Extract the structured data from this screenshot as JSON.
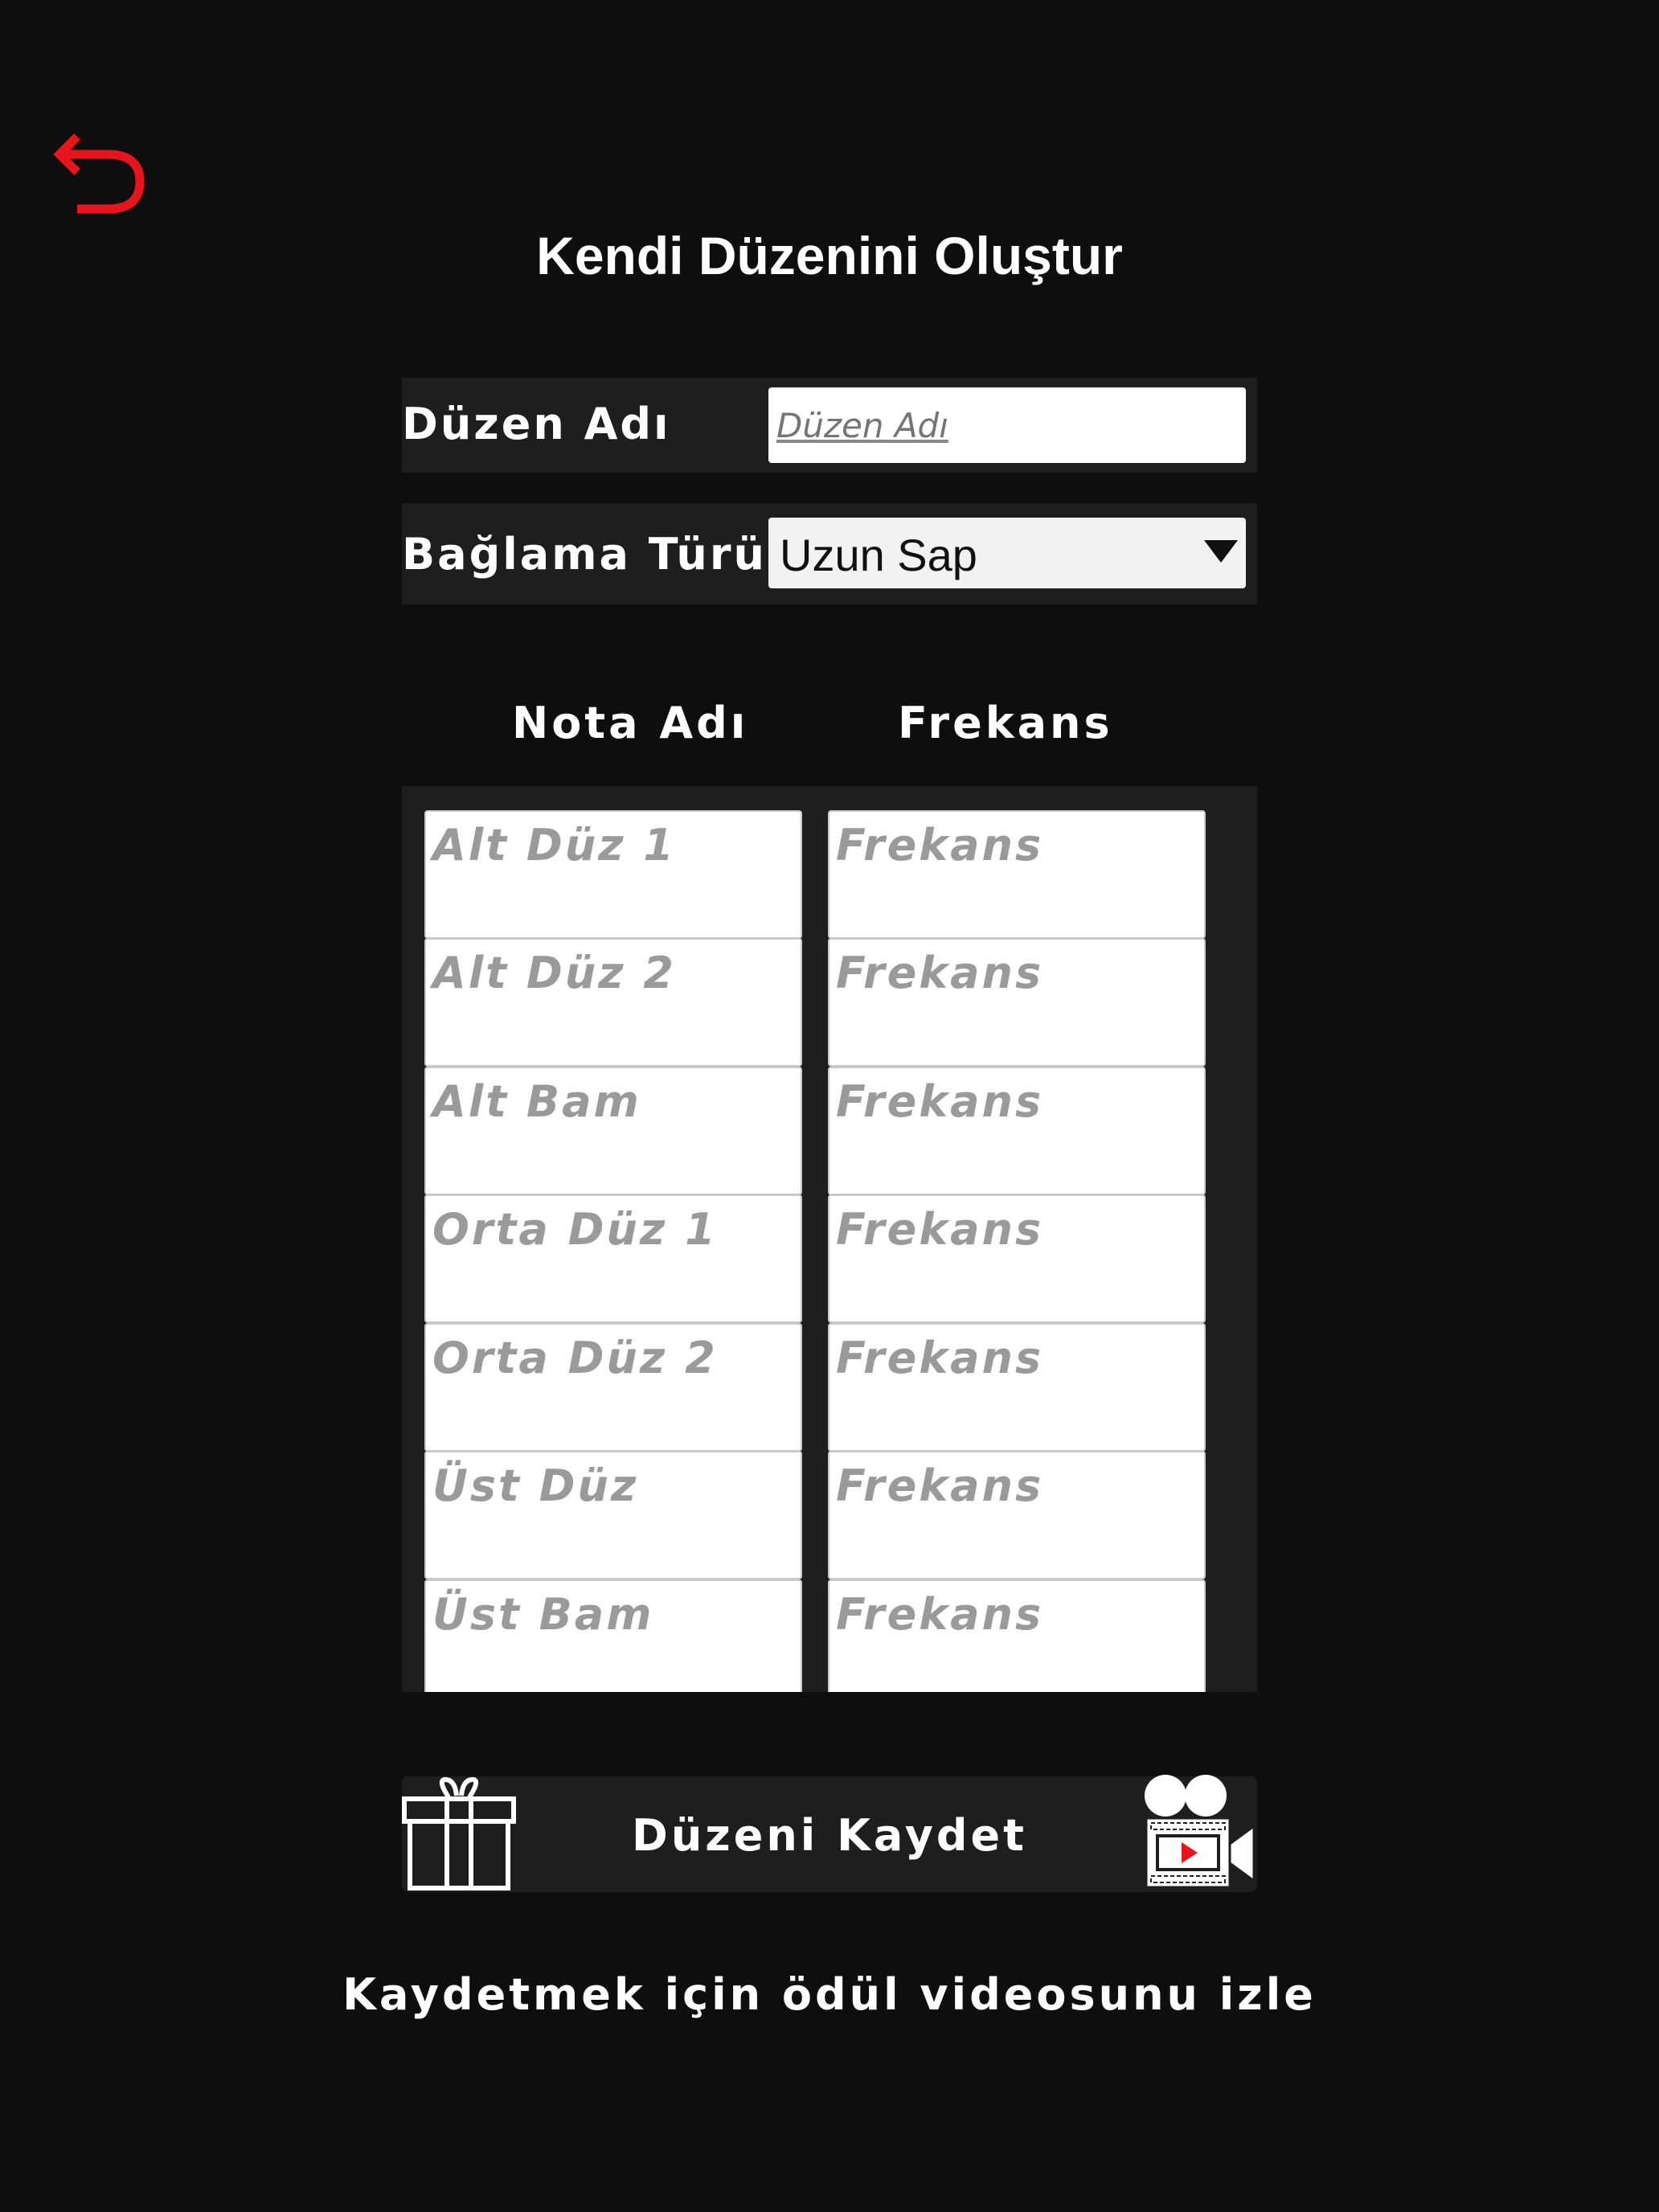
{
  "header": {
    "title": "Kendi Düzenini Oluştur",
    "back_icon": "undo-arrow-icon",
    "back_color": "#e8141b"
  },
  "form": {
    "name_label": "Düzen Adı",
    "name_value": "",
    "name_placeholder": "Düzen Adı",
    "type_label": "Bağlama Türü",
    "type_selected": "Uzun Sap"
  },
  "columns": {
    "note_header": "Nota Adı",
    "freq_header": "Frekans"
  },
  "notes": [
    {
      "placeholder": "Alt Düz 1",
      "freq_placeholder": "Frekans"
    },
    {
      "placeholder": "Alt Düz 2",
      "freq_placeholder": "Frekans"
    },
    {
      "placeholder": "Alt Bam",
      "freq_placeholder": "Frekans"
    },
    {
      "placeholder": "Orta Düz 1",
      "freq_placeholder": "Frekans"
    },
    {
      "placeholder": "Orta Düz 2",
      "freq_placeholder": "Frekans"
    },
    {
      "placeholder": "Üst Düz",
      "freq_placeholder": "Frekans"
    },
    {
      "placeholder": "Üst Bam",
      "freq_placeholder": "Frekans"
    }
  ],
  "save": {
    "label": "Düzeni Kaydet",
    "left_icon": "gift-icon",
    "right_icon": "video-camera-icon"
  },
  "hint": "Kaydetmek için ödül videosunu izle",
  "colors": {
    "background": "#0e0e0f",
    "panel": "#1e1e1f",
    "accent": "#e8141b"
  }
}
